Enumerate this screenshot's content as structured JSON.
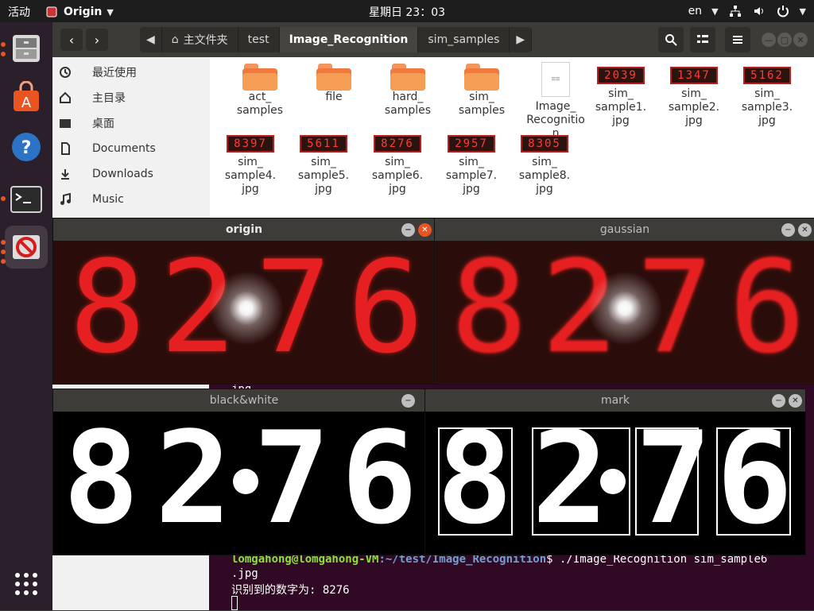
{
  "top_panel": {
    "activities": "活动",
    "app_name": "Origin",
    "clock": "星期日 23：03",
    "lang": "en"
  },
  "files": {
    "breadcrumb": {
      "home": "主文件夹",
      "test": "test",
      "current": "Image_Recognition",
      "next": "sim_samples"
    },
    "sidebar": [
      {
        "label": "最近使用",
        "icon": "clock-icon"
      },
      {
        "label": "主目录",
        "icon": "home-icon"
      },
      {
        "label": "桌面",
        "icon": "folder-icon"
      },
      {
        "label": "Documents",
        "icon": "document-icon"
      },
      {
        "label": "Downloads",
        "icon": "download-icon"
      },
      {
        "label": "Music",
        "icon": "music-icon"
      }
    ],
    "items": [
      {
        "type": "folder",
        "l1": "act_",
        "l2": "samples"
      },
      {
        "type": "folder",
        "l1": "file",
        "l2": ""
      },
      {
        "type": "folder",
        "l1": "hard_",
        "l2": "samples"
      },
      {
        "type": "folder",
        "l1": "sim_",
        "l2": "samples"
      },
      {
        "type": "doc",
        "l1": "Image_",
        "l2": "Recognitio",
        "l3": "n"
      },
      {
        "type": "image",
        "thumb": "2039",
        "l1": "sim_",
        "l2": "sample1.",
        "l3": "jpg"
      },
      {
        "type": "image",
        "thumb": "1347",
        "l1": "sim_",
        "l2": "sample2.",
        "l3": "jpg"
      },
      {
        "type": "image",
        "thumb": "5162",
        "l1": "sim_",
        "l2": "sample3.",
        "l3": "jpg"
      },
      {
        "type": "image",
        "thumb": "8397",
        "l1": "sim_",
        "l2": "sample4.",
        "l3": "jpg"
      },
      {
        "type": "image",
        "thumb": "5611",
        "l1": "sim_",
        "l2": "sample5.",
        "l3": "jpg"
      },
      {
        "type": "image",
        "thumb": "8276",
        "l1": "sim_",
        "l2": "sample6.",
        "l3": "jpg"
      },
      {
        "type": "image",
        "thumb": "2957",
        "l1": "sim_",
        "l2": "sample7.",
        "l3": "jpg"
      },
      {
        "type": "image",
        "thumb": "8305",
        "l1": "sim_",
        "l2": "sample8.",
        "l3": "jpg"
      }
    ]
  },
  "windows": {
    "origin_title": "origin",
    "gaussian_title": "gaussian",
    "bw_title": "black&white",
    "mark_title": "mark",
    "digits": [
      "8",
      "2",
      "7",
      "6"
    ]
  },
  "terminal": {
    "partial_text": "jpg",
    "prompt_user": "lomgahong@lomgahong-VM",
    "prompt_path": ":~/test/Image_Recognition",
    "command": "$ ./Image_Recognition sim_sample6",
    "command_wrap": ".jpg",
    "result": "识别到的数字为: 8276"
  },
  "colors": {
    "dock_bg": "#2a1f2a",
    "terminal_bg": "#300a24",
    "accent": "#e95420"
  }
}
